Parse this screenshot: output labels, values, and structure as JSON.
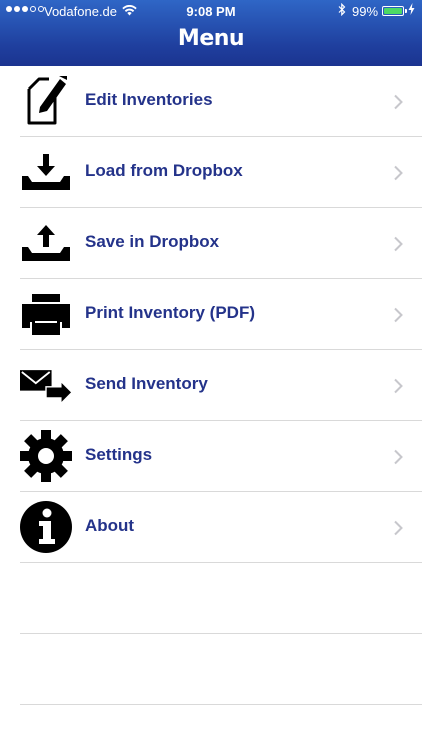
{
  "status_bar": {
    "carrier": "Vodafone.de",
    "time": "9:08 PM",
    "battery_percent": "99%",
    "battery_level": 0.99,
    "battery_color": "#4cd964"
  },
  "nav": {
    "title": "Menu",
    "color": "#1f3f9e"
  },
  "menu": {
    "label_color": "#24338a",
    "items": [
      {
        "label": "Edit Inventories",
        "icon": "edit-document-icon"
      },
      {
        "label": "Load from Dropbox",
        "icon": "download-tray-icon"
      },
      {
        "label": "Save in Dropbox",
        "icon": "upload-tray-icon"
      },
      {
        "label": "Print Inventory (PDF)",
        "icon": "printer-icon"
      },
      {
        "label": "Send Inventory",
        "icon": "send-mail-icon"
      },
      {
        "label": "Settings",
        "icon": "gear-icon"
      },
      {
        "label": "About",
        "icon": "info-icon"
      }
    ]
  }
}
